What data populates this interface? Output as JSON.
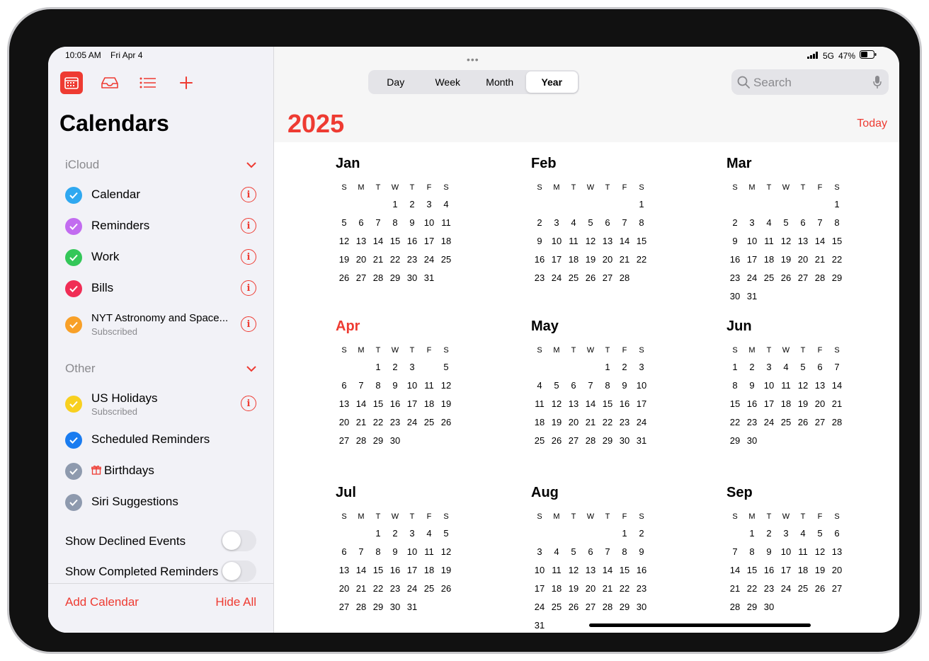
{
  "status": {
    "time": "10:05 AM",
    "date": "Fri Apr 4",
    "signal": "5G",
    "battery": "47%"
  },
  "sidebar": {
    "title": "Calendars",
    "sections": [
      {
        "name": "iCloud",
        "items": [
          {
            "label": "Calendar",
            "sub": "",
            "color": "#2fa8f0",
            "info": true
          },
          {
            "label": "Reminders",
            "sub": "",
            "color": "#c26cf0",
            "info": true
          },
          {
            "label": "Work",
            "sub": "",
            "color": "#34c759",
            "info": true
          },
          {
            "label": "Bills",
            "sub": "",
            "color": "#f02d55",
            "info": true
          },
          {
            "label": "NYT Astronomy and Space...",
            "sub": "Subscribed",
            "color": "#f8a028",
            "info": true
          }
        ]
      },
      {
        "name": "Other",
        "items": [
          {
            "label": "US Holidays",
            "sub": "Subscribed",
            "color": "#f8d020",
            "info": true
          },
          {
            "label": "Scheduled Reminders",
            "sub": "",
            "color": "#1a7cf0",
            "info": false
          },
          {
            "label": "Birthdays",
            "sub": "",
            "color": "#8e9aae",
            "info": false
          },
          {
            "label": "Siri Suggestions",
            "sub": "",
            "color": "#8e9aae",
            "info": false
          }
        ]
      }
    ],
    "toggles": [
      {
        "label": "Show Declined Events"
      },
      {
        "label": "Show Completed Reminders"
      }
    ],
    "footer": {
      "add": "Add Calendar",
      "hide": "Hide All"
    }
  },
  "view_modes": [
    "Day",
    "Week",
    "Month",
    "Year"
  ],
  "active_view": "Year",
  "search_placeholder": "Search",
  "year": "2025",
  "today_label": "Today",
  "dow": [
    "S",
    "M",
    "T",
    "W",
    "T",
    "F",
    "S"
  ],
  "current_month": 3,
  "current_day": 4,
  "months": [
    {
      "name": "Jan",
      "start": 3,
      "days": 31
    },
    {
      "name": "Feb",
      "start": 6,
      "days": 28
    },
    {
      "name": "Mar",
      "start": 6,
      "days": 31
    },
    {
      "name": "Apr",
      "start": 2,
      "days": 30
    },
    {
      "name": "May",
      "start": 4,
      "days": 31
    },
    {
      "name": "Jun",
      "start": 0,
      "days": 30
    },
    {
      "name": "Jul",
      "start": 2,
      "days": 31
    },
    {
      "name": "Aug",
      "start": 5,
      "days": 31
    },
    {
      "name": "Sep",
      "start": 1,
      "days": 30
    }
  ]
}
